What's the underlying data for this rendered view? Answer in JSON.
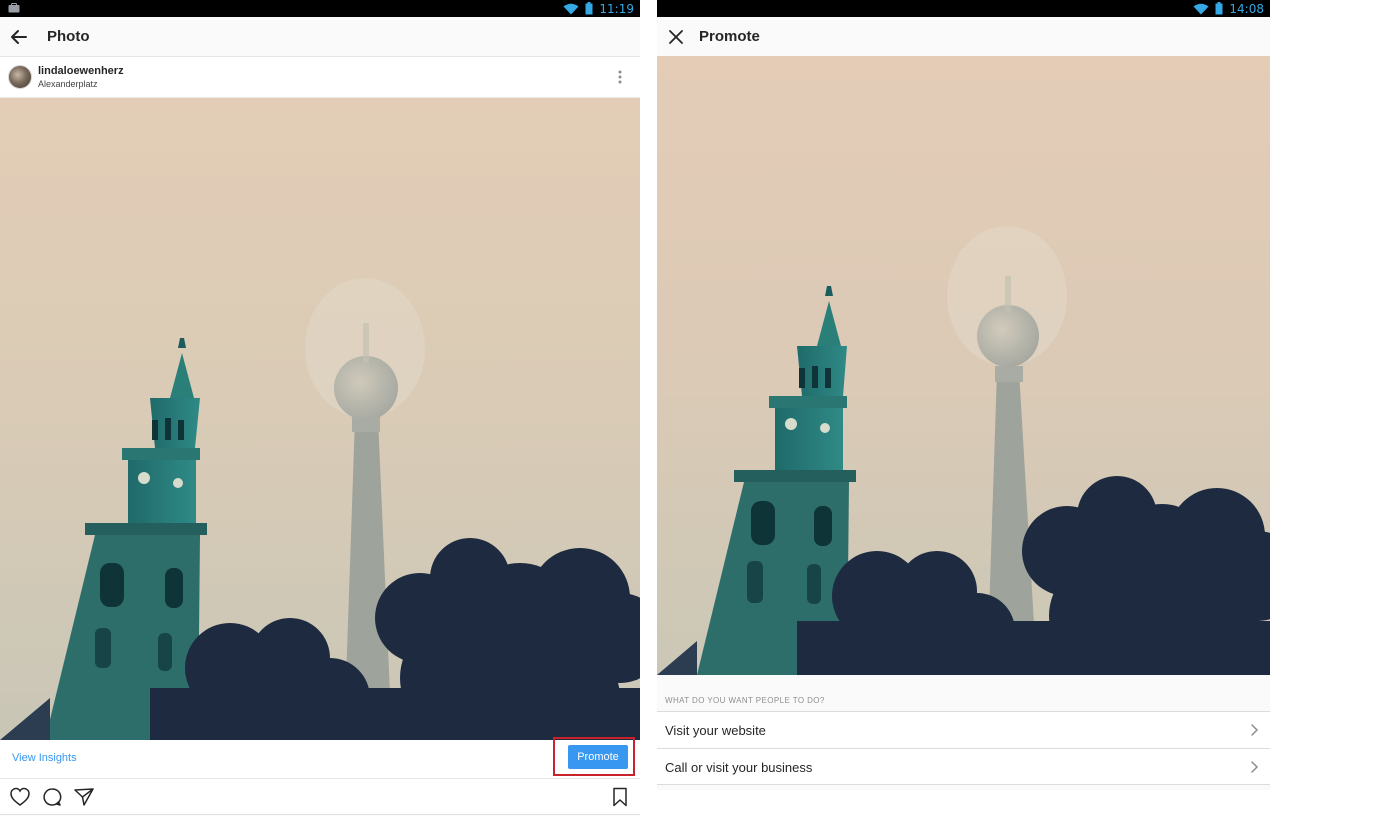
{
  "left_screen": {
    "status_bar": {
      "time": "11:19"
    },
    "top_bar": {
      "title": "Photo",
      "back_icon": "arrow-left-icon"
    },
    "post": {
      "username": "lindaloewenherz",
      "location": "Alexanderplatz"
    },
    "actions": {
      "view_insights": "View Insights",
      "promote": "Promote"
    },
    "icons": [
      "heart-icon",
      "comment-icon",
      "share-icon",
      "bookmark-icon"
    ],
    "accent_color": "#3897f0",
    "highlight_color": "#c8232c"
  },
  "right_screen": {
    "status_bar": {
      "time": "14:08"
    },
    "top_bar": {
      "title": "Promote",
      "close_icon": "close-icon"
    },
    "section_label": "WHAT DO YOU WANT PEOPLE TO DO?",
    "options": [
      {
        "label": "Visit your website"
      },
      {
        "label": "Call or visit your business"
      }
    ]
  }
}
